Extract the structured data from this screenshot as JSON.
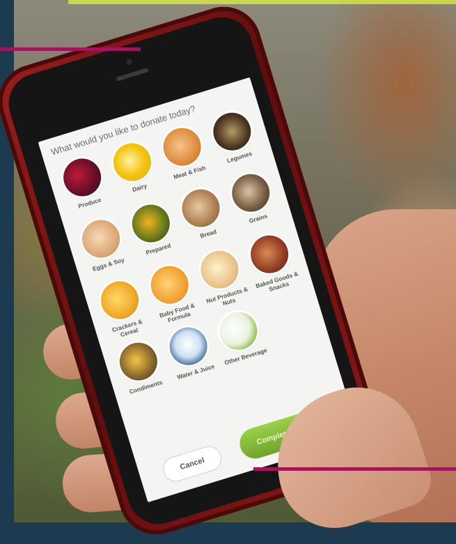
{
  "screen": {
    "prompt": "What would you like to donate today?",
    "categories": [
      {
        "label": "Produce",
        "icon": "produce-icon"
      },
      {
        "label": "Dairy",
        "icon": "dairy-icon"
      },
      {
        "label": "Meat & Fish",
        "icon": "meat-fish-icon"
      },
      {
        "label": "Legumes",
        "icon": "legumes-icon"
      },
      {
        "label": "Eggs & Soy",
        "icon": "eggs-soy-icon"
      },
      {
        "label": "Prepared",
        "icon": "prepared-icon"
      },
      {
        "label": "Bread",
        "icon": "bread-icon"
      },
      {
        "label": "Grains",
        "icon": "grains-icon"
      },
      {
        "label": "Crackers & Cereal",
        "icon": "crackers-cereal-icon"
      },
      {
        "label": "Baby Food & Formula",
        "icon": "baby-food-icon"
      },
      {
        "label": "Nut Products & Nuts",
        "icon": "nut-products-icon"
      },
      {
        "label": "Baked Goods & Snacks",
        "icon": "baked-goods-icon"
      },
      {
        "label": "Condiments",
        "icon": "condiments-icon"
      },
      {
        "label": "Water & Juice",
        "icon": "water-juice-icon"
      },
      {
        "label": "Other Beverage",
        "icon": "other-beverage-icon"
      }
    ],
    "buttons": {
      "cancel": "Cancel",
      "complete": "Complete Donation"
    }
  },
  "colors": {
    "accent_magenta": "#a3155a",
    "accent_lime": "#c8d64a",
    "frame_navy": "#1c3b50",
    "phone_red": "#9a1d1d",
    "button_green": "#7fb534"
  }
}
